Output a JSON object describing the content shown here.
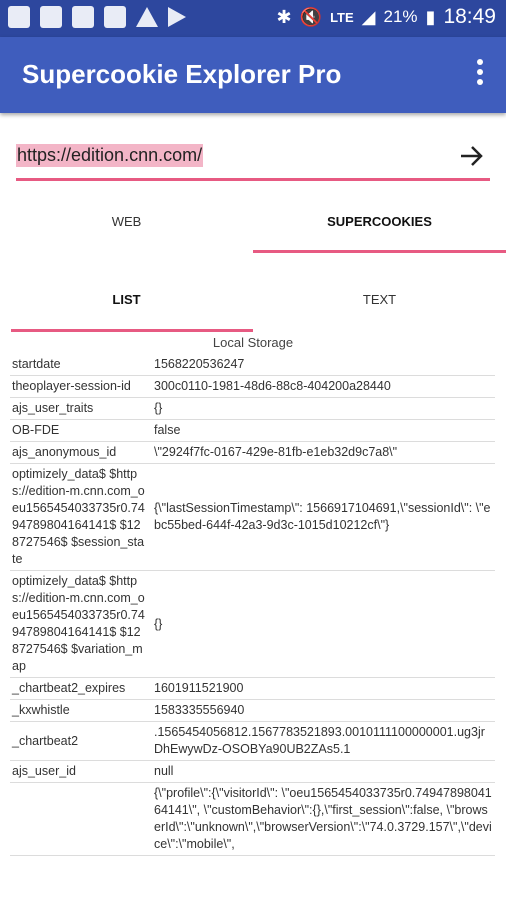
{
  "status_bar": {
    "left_icons": [
      "image-icon",
      "bluetooth-notification-icon",
      "gb-icon",
      "gb-icon",
      "warning-icon",
      "play-store-icon"
    ],
    "right_icons": [
      "bluetooth-icon",
      "mute-icon",
      "lte-icon",
      "signal-icon"
    ],
    "network": "LTE",
    "battery": "21%",
    "time": "18:49"
  },
  "app_bar": {
    "title": "Supercookie Explorer Pro",
    "menu_icon": "more-vert-icon"
  },
  "url_input": {
    "value": "https://edition.cnn.com/",
    "go_icon": "arrow-right-icon",
    "accent_color": "#e75a82"
  },
  "tabs": [
    "WEB",
    "SUPERCOOKIES"
  ],
  "sub_tabs": [
    "LIST",
    "TEXT"
  ],
  "section_title": "Local Storage",
  "rows": [
    {
      "key": "startdate",
      "value": "1568220536247"
    },
    {
      "key": "theoplayer-session-id",
      "value": "300c0110-1981-48d6-88c8-404200a28440"
    },
    {
      "key": "ajs_user_traits",
      "value": "{}"
    },
    {
      "key": "OB-FDE",
      "value": "false"
    },
    {
      "key": "ajs_anonymous_id",
      "value": "\\\"2924f7fc-0167-429e-81fb-e1eb32d9c7a8\\\""
    },
    {
      "key": "optimizely_data$ $https://edition-m.cnn.com_oeu1565454033735r0.7494789804164141$ $128727546$ $session_state",
      "value": "{\\\"lastSessionTimestamp\\\": 1566917104691,\\\"sessionId\\\": \\\"ebc55bed-644f-42a3-9d3c-1015d10212cf\\\"}"
    },
    {
      "key": "optimizely_data$ $https://edition-m.cnn.com_oeu1565454033735r0.7494789804164141$ $128727546$ $variation_map",
      "value": "{}"
    },
    {
      "key": "_chartbeat2_expires",
      "value": "1601911521900"
    },
    {
      "key": "_kxwhistle",
      "value": "1583335556940"
    },
    {
      "key": "_chartbeat2",
      "value": ".1565454056812.1567783521893.0010111100000001.ug3jrDhEwywDz-OSOBYa90UB2ZAs5.1"
    },
    {
      "key": "ajs_user_id",
      "value": "null"
    },
    {
      "key": "",
      "value": "{\\\"profile\\\":{\\\"visitorId\\\": \\\"oeu1565454033735r0.7494789804164141\\\", \\\"customBehavior\\\":{},\\\"first_session\\\":false, \\\"browserId\\\":\\\"unknown\\\",\\\"browserVersion\\\":\\\"74.0.3729.157\\\",\\\"device\\\":\\\"mobile\\\","
    }
  ]
}
